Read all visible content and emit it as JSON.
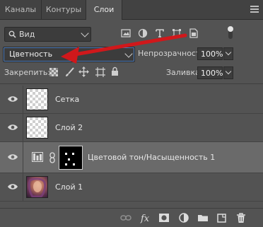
{
  "tabs": [
    {
      "label": "Каналы"
    },
    {
      "label": "Контуры"
    },
    {
      "label": "Слои"
    }
  ],
  "filter": {
    "selected": "Вид"
  },
  "blend_mode": {
    "selected": "Цветность"
  },
  "opacity": {
    "label": "Непрозрачность:",
    "value": "100%"
  },
  "lock": {
    "label": "Закрепить:"
  },
  "fill": {
    "label": "Заливка:",
    "value": "100%"
  },
  "layers": [
    {
      "name": "Сетка"
    },
    {
      "name": "Слой 2"
    },
    {
      "name": "Цветовой тон/Насыщенность 1"
    },
    {
      "name": "Слой 1"
    }
  ],
  "bottom_icons": [
    "link-icon",
    "fx-icon",
    "mask-icon",
    "adjustment-icon",
    "folder-icon",
    "new-layer-icon",
    "trash-icon"
  ],
  "colors": {
    "accent_arrow": "#d0181b",
    "panel": "#535353",
    "selected_row": "#6a6a6a"
  }
}
